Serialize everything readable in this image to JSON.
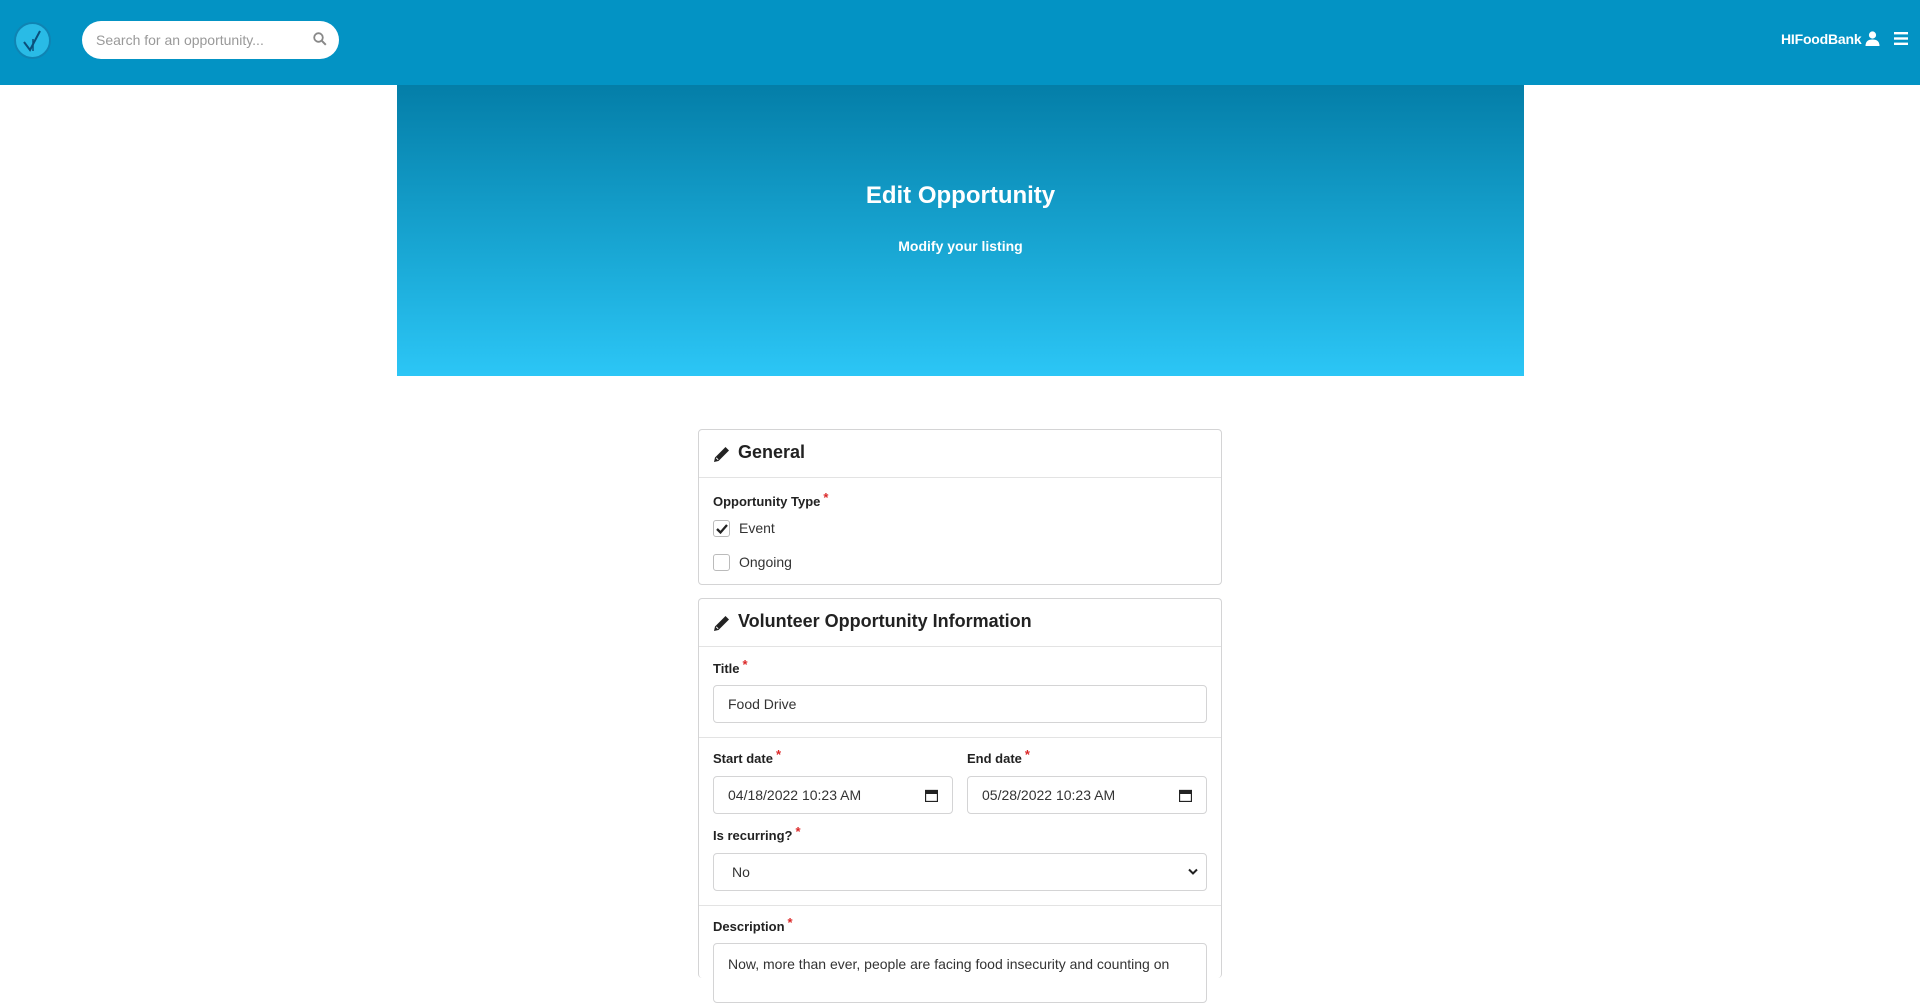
{
  "navbar": {
    "search_placeholder": "Search for an opportunity...",
    "user_name": "HIFoodBank"
  },
  "hero": {
    "title": "Edit Opportunity",
    "subtitle": "Modify your listing"
  },
  "general": {
    "heading": "General",
    "opportunity_type_label": "Opportunity Type",
    "options": [
      {
        "label": "Event",
        "checked": true
      },
      {
        "label": "Ongoing",
        "checked": false
      }
    ]
  },
  "info": {
    "heading": "Volunteer Opportunity Information",
    "title_label": "Title",
    "title_value": "Food Drive",
    "start_label": "Start date",
    "start_value": "04/18/2022 10:23 AM",
    "end_label": "End date",
    "end_value": "05/28/2022 10:23 AM",
    "recurring_label": "Is recurring?",
    "recurring_value": "No",
    "description_label": "Description",
    "description_value": "Now, more than ever, people are facing food insecurity and counting on"
  },
  "colors": {
    "navbar": "#0393c4",
    "required": "#db2828"
  }
}
